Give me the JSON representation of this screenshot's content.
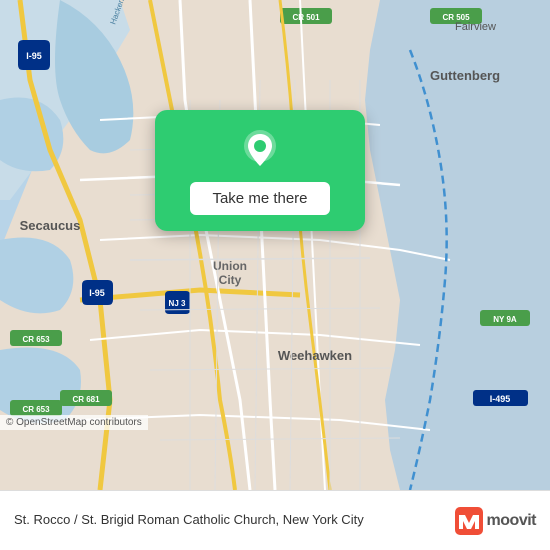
{
  "map": {
    "attribution": "© OpenStreetMap contributors",
    "alt": "Map showing St. Rocco / St. Brigid area in Union City, NJ"
  },
  "card": {
    "button_label": "Take me there"
  },
  "bottom_bar": {
    "location_label": "St. Rocco / St. Brigid Roman Catholic Church, New York City",
    "brand": "moovit"
  },
  "colors": {
    "green": "#2ecc71",
    "white": "#ffffff",
    "road_yellow": "#f0d060",
    "road_white": "#ffffff",
    "water": "#b8d4e8",
    "land": "#e8e0d4",
    "highway": "#f0c040"
  }
}
